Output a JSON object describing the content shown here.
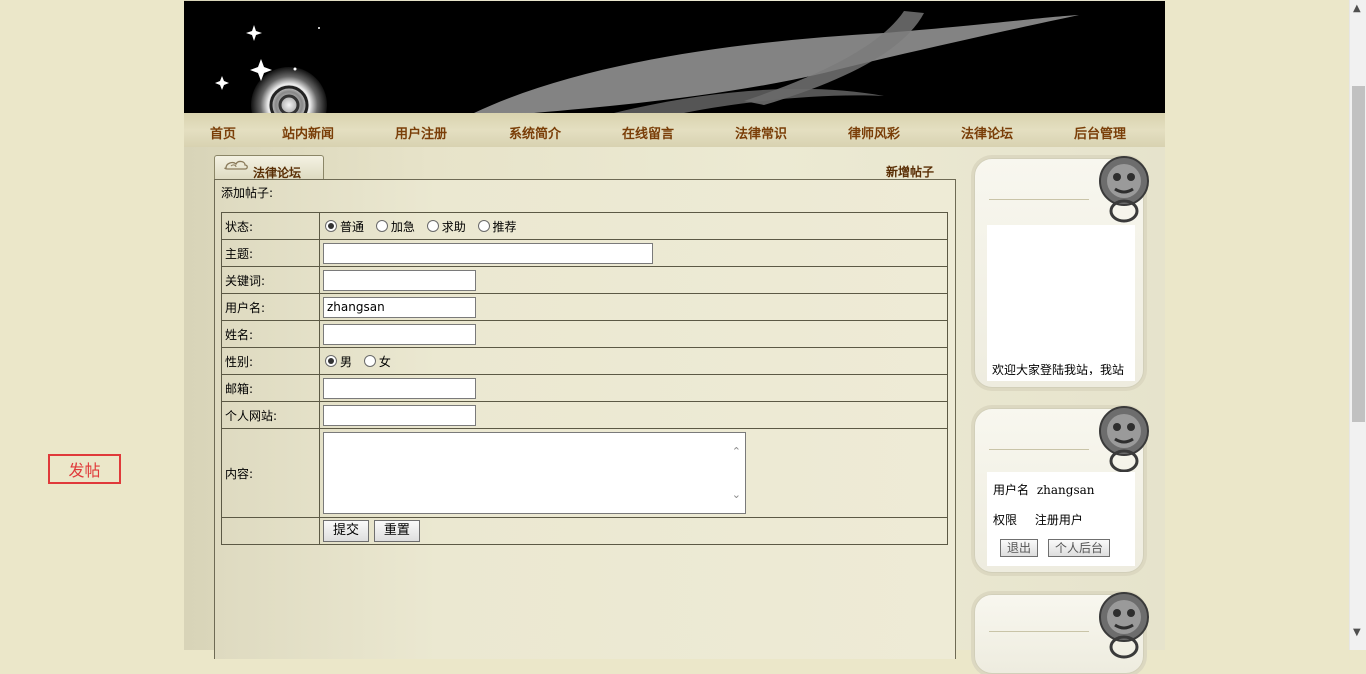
{
  "nav": {
    "items": [
      "首页",
      "站内新闻",
      "用户注册",
      "系统简介",
      "在线留言",
      "法律常识",
      "律师风彩",
      "法律论坛",
      "后台管理"
    ]
  },
  "forum": {
    "tab_label": "法律论坛",
    "new_post_link": "新增帖子",
    "add_title": "添加帖子:"
  },
  "form": {
    "status_label": "状态:",
    "status_options": [
      "普通",
      "加急",
      "求助",
      "推荐"
    ],
    "status_selected": "普通",
    "subject_label": "主题:",
    "subject_value": "",
    "keyword_label": "关键词:",
    "keyword_value": "",
    "username_label": "用户名:",
    "username_value": "zhangsan",
    "name_label": "姓名:",
    "name_value": "",
    "gender_label": "性别:",
    "gender_options": [
      "男",
      "女"
    ],
    "gender_selected": "男",
    "email_label": "邮箱:",
    "email_value": "",
    "website_label": "个人网站:",
    "website_value": "",
    "content_label": "内容:",
    "content_value": "",
    "submit_label": "提交",
    "reset_label": "重置"
  },
  "sidebar": {
    "welcome_text": "欢迎大家登陆我站，我站",
    "user": {
      "username_label": "用户名",
      "username_value": "zhangsan",
      "role_label": "权限",
      "role_value": "注册用户",
      "logout_label": "退出",
      "personal_label": "个人后台"
    }
  },
  "float_button": {
    "label": "发帖",
    "color": "#e03a3a"
  },
  "colors": {
    "nav_text": "#7a3e08",
    "page_bg": "#ebe7c9",
    "banner_bg": "#000000"
  }
}
